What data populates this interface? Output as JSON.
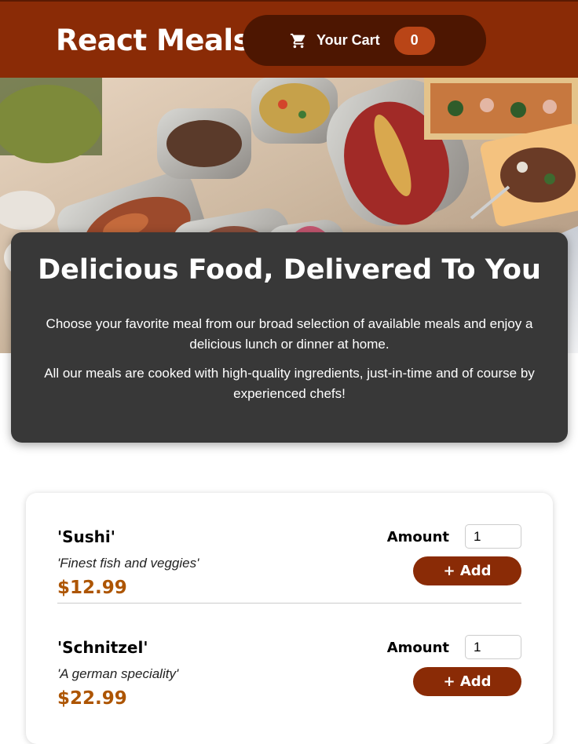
{
  "header": {
    "app_title": "React Meals",
    "cart_label": "Your Cart",
    "cart_count": "0",
    "cart_icon": "cart-icon"
  },
  "hero": {
    "image_alt": "A table full of delicious food"
  },
  "summary": {
    "title": "Delicious Food, Delivered To You",
    "paragraph_1": "Choose your favorite meal from our broad selection of available meals and enjoy a delicious lunch or dinner at home.",
    "paragraph_2": "All our meals are cooked with high-quality ingredients, just-in-time and of course by experienced chefs!"
  },
  "meals": [
    {
      "name": "'Sushi'",
      "description": "'Finest fish and veggies'",
      "price": "$12.99",
      "amount_label": "Amount",
      "amount_value": "1",
      "add_label": "+ Add"
    },
    {
      "name": "'Schnitzel'",
      "description": "'A german speciality'",
      "price": "$22.99",
      "amount_label": "Amount",
      "amount_value": "1",
      "add_label": "+ Add"
    }
  ],
  "colors": {
    "header_bg": "#8a2b06",
    "cart_button_bg": "#4d1601",
    "cart_badge_bg": "#b94517",
    "summary_bg": "#383838",
    "price": "#ad5502",
    "add_button_bg": "#8a2b06"
  }
}
